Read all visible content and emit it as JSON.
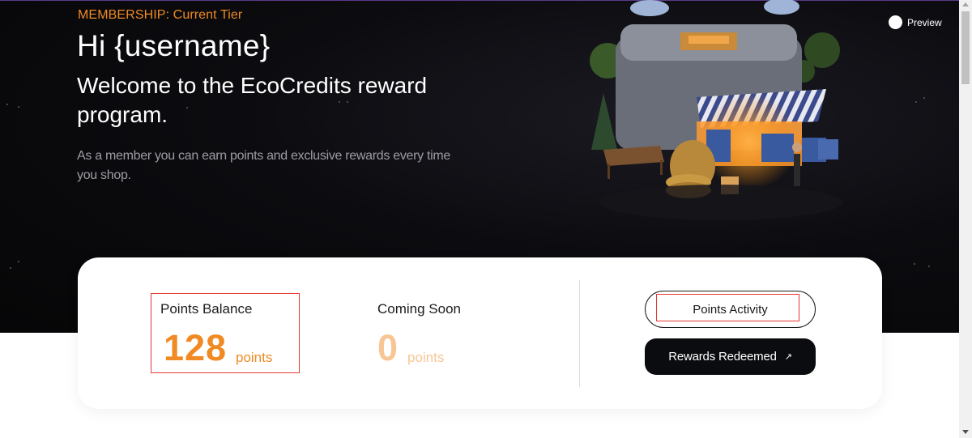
{
  "hero": {
    "tier_label": "MEMBERSHIP: Current Tier",
    "greeting": "Hi {username}",
    "welcome": "Welcome to the EcoCredits reward program.",
    "description": "As a member you can earn points and exclusive rewards every time you shop."
  },
  "preview": {
    "label": "Preview"
  },
  "stats": {
    "balance": {
      "label": "Points Balance",
      "value": "128",
      "unit": "points"
    },
    "coming_soon": {
      "label": "Coming Soon",
      "value": "0",
      "unit": "points"
    }
  },
  "actions": {
    "points_activity": "Points Activity",
    "rewards_redeemed": "Rewards Redeemed",
    "rewards_redeemed_icon": "arrow-up-right-icon"
  },
  "colors": {
    "accent_orange": "#f08a24",
    "faded_orange": "#f8c694",
    "dark": "#0b0c10",
    "highlight_red": "#e53935"
  }
}
